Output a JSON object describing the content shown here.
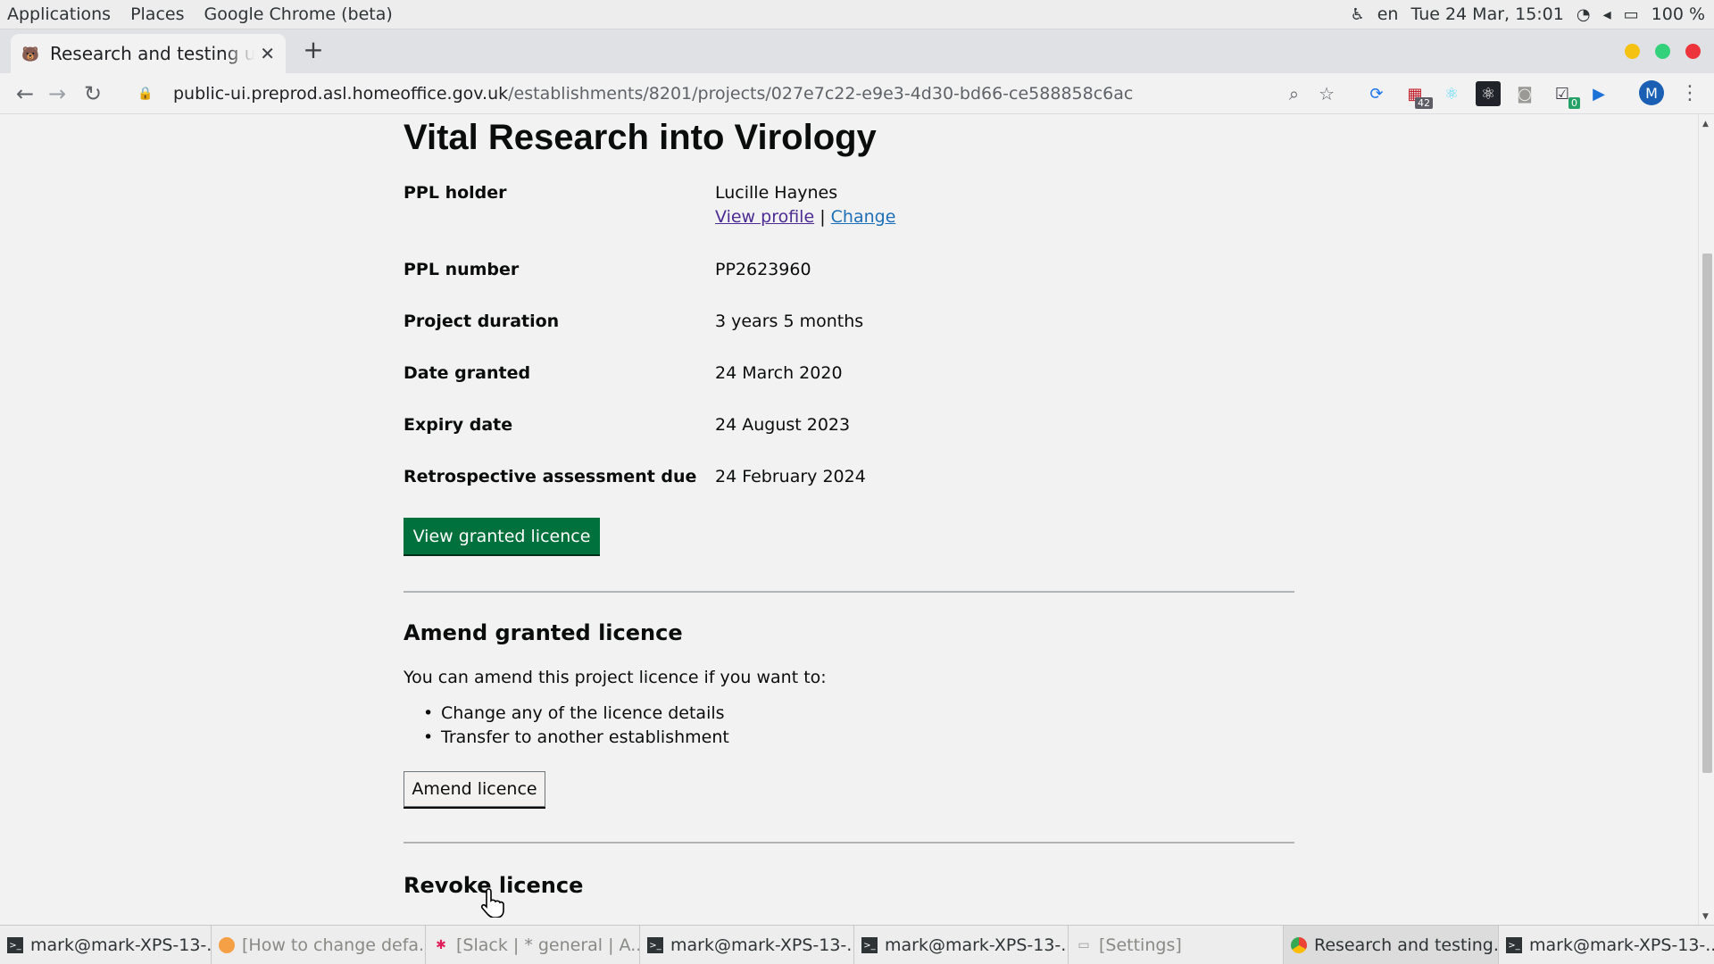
{
  "topbar": {
    "applications": "Applications",
    "places": "Places",
    "app_name": "Google Chrome (beta)",
    "lang": "en",
    "datetime": "Tue 24 Mar, 15:01",
    "battery": "100 %"
  },
  "tab": {
    "title": "Research and testing u",
    "close": "✕"
  },
  "toolbar": {
    "url_host": "public-ui.preprod.asl.homeoffice.gov.uk",
    "url_path": "/establishments/8201/projects/027e7c22-e9e3-4d30-bd66-ce588858c6ac",
    "ext_badge_1": "42",
    "ext_badge_2": "0",
    "profile_initial": "M"
  },
  "page": {
    "title": "Vital Research into Virology",
    "details": {
      "ppl_holder_label": "PPL holder",
      "ppl_holder_value": "Lucille Haynes",
      "view_profile_link": "View profile",
      "link_separator": "|",
      "change_link": "Change",
      "ppl_number_label": "PPL number",
      "ppl_number_value": "PP2623960",
      "duration_label": "Project duration",
      "duration_value": "3 years 5 months",
      "granted_label": "Date granted",
      "granted_value": "24 March 2020",
      "expiry_label": "Expiry date",
      "expiry_value": "24 August 2023",
      "retro_label": "Retrospective assessment due",
      "retro_value": "24 February 2024"
    },
    "view_licence_button": "View granted licence",
    "amend": {
      "heading": "Amend granted licence",
      "intro": "You can amend this project licence if you want to:",
      "bullets": [
        "Change any of the licence details",
        "Transfer to another establishment"
      ],
      "button": "Amend licence"
    },
    "revoke": {
      "heading": "Revoke licence"
    }
  },
  "taskbar": {
    "items": [
      "mark@mark-XPS-13-...",
      "[How to change defa...",
      "[Slack | * general | A...",
      "mark@mark-XPS-13-...",
      "mark@mark-XPS-13-...",
      "[Settings]",
      "Research and testing...",
      "mark@mark-XPS-13-..."
    ]
  },
  "colors": {
    "govuk_green": "#00703c",
    "link_blue": "#1d70b8",
    "link_visited": "#4c2c92",
    "text": "#0b0c0c"
  }
}
